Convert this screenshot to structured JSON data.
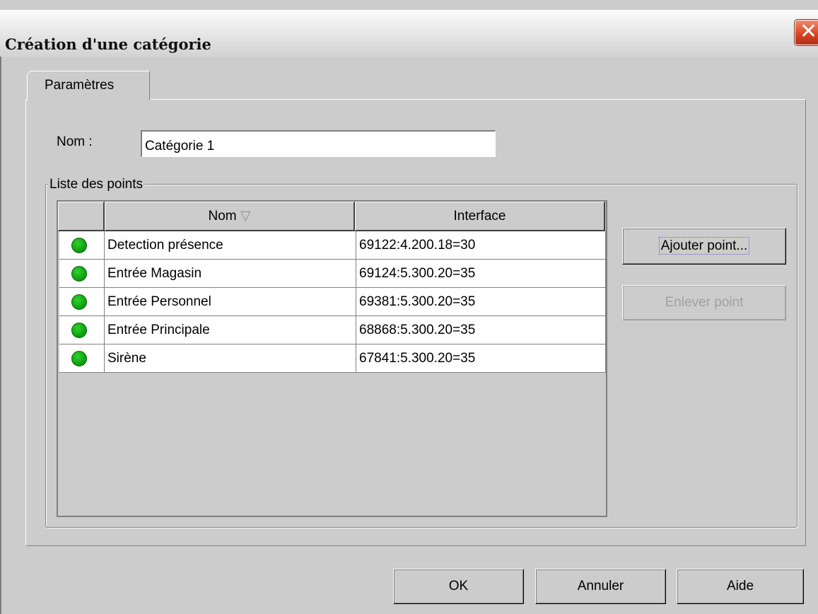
{
  "window": {
    "title": "Création d'une catégorie",
    "close_glyph": "✕"
  },
  "tabs": [
    {
      "label": "Paramètres"
    }
  ],
  "form": {
    "name_label": "Nom :",
    "name_value": "Catégorie 1"
  },
  "points_group": {
    "title": "Liste des points",
    "columns": {
      "name": "Nom",
      "name_sort_icon": "▽",
      "interface": "Interface"
    },
    "rows": [
      {
        "status": "green",
        "name": "Detection présence",
        "interface": "69122:4.200.18=30"
      },
      {
        "status": "green",
        "name": "Entrée Magasin",
        "interface": "69124:5.300.20=35"
      },
      {
        "status": "green",
        "name": "Entrée Personnel",
        "interface": "69381:5.300.20=35"
      },
      {
        "status": "green",
        "name": "Entrée Principale",
        "interface": "68868:5.300.20=35"
      },
      {
        "status": "green",
        "name": "Sirène",
        "interface": "67841:5.300.20=35"
      }
    ],
    "add_button": "Ajouter point...",
    "remove_button": "Enlever point"
  },
  "footer": {
    "ok": "OK",
    "cancel": "Annuler",
    "help": "Aide"
  }
}
